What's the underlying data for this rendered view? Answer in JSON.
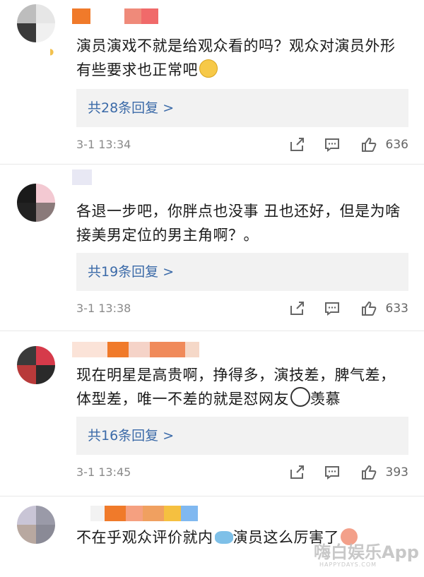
{
  "comments": [
    {
      "text": "演员演戏不就是给观众看的吗？观众对演员外形有些要求也正常吧",
      "emoji": "crying-laughing-emoji",
      "replies_label": "共28条回复 >",
      "time": "3-1 13:34",
      "likes": "636"
    },
    {
      "text": "各退一步吧，你胖点也没事 丑也还好，但是为啥接美男定位的男主角啊？。",
      "replies_label": "共19条回复 >",
      "time": "3-1 13:38",
      "likes": "633"
    },
    {
      "text_a": "现在明星是高贵啊，挣得多，演技差，脾气差，体型差，唯一不差的就是怼网友",
      "emoji": "panda-emoji",
      "text_b": "羡慕",
      "replies_label": "共16条回复 >",
      "time": "3-1 13:45",
      "likes": "393"
    },
    {
      "text_a": "不在乎观众评价就内",
      "emoji_fish": "fish-emoji",
      "text_b": "演员这么厉害了",
      "emoji_end": "laughing-emoji"
    }
  ],
  "watermark": "嗨白娱乐App",
  "watermark_sub": "HAPPYDAYS.COM"
}
